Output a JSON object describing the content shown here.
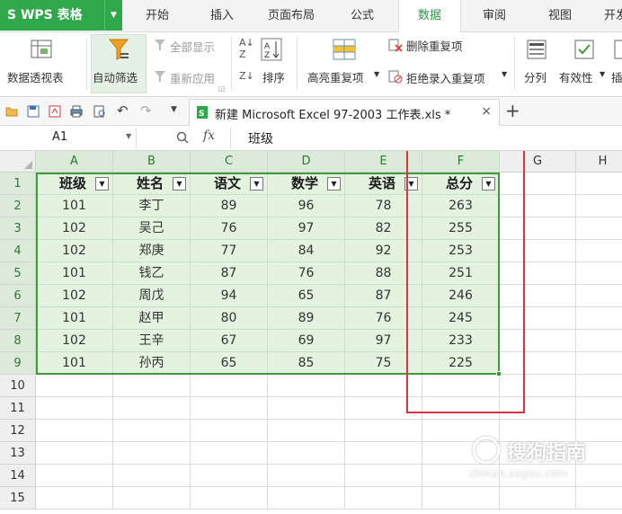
{
  "app": {
    "logo": "S WPS 表格",
    "tabs": [
      "开始",
      "插入",
      "页面布局",
      "公式",
      "数据",
      "审阅",
      "视图",
      "开发"
    ],
    "active_tab": "数据"
  },
  "ribbon": {
    "pivot": "数据透视表",
    "autofilter": "自动筛选",
    "show_all": "全部显示",
    "reapply": "重新应用",
    "sort": "排序",
    "highlight_dup": "高亮重复项",
    "remove_dup": "删除重复项",
    "reject_dup": "拒绝录入重复项",
    "split_col": "分列",
    "validity": "有效性",
    "insert_more": "插"
  },
  "doc": {
    "title": "新建 Microsoft Excel 97-2003 工作表.xls *",
    "close": "×",
    "new_tab": "+"
  },
  "formula_bar": {
    "cell_ref": "A1",
    "fx": "fx",
    "value": "班级"
  },
  "sheet": {
    "columns": [
      "A",
      "B",
      "C",
      "D",
      "E",
      "F",
      "G",
      "H"
    ],
    "rows": [
      "1",
      "2",
      "3",
      "4",
      "5",
      "6",
      "7",
      "8",
      "9",
      "10",
      "11",
      "12",
      "13",
      "14",
      "15"
    ],
    "headers": [
      "班级",
      "姓名",
      "语文",
      "数学",
      "英语",
      "总分"
    ],
    "data": [
      [
        "101",
        "李丁",
        "89",
        "96",
        "78",
        "263"
      ],
      [
        "102",
        "吴己",
        "76",
        "97",
        "82",
        "255"
      ],
      [
        "102",
        "郑庚",
        "77",
        "84",
        "92",
        "253"
      ],
      [
        "101",
        "钱乙",
        "87",
        "76",
        "88",
        "251"
      ],
      [
        "102",
        "周戊",
        "94",
        "65",
        "87",
        "246"
      ],
      [
        "101",
        "赵甲",
        "80",
        "89",
        "76",
        "245"
      ],
      [
        "102",
        "王辛",
        "67",
        "69",
        "97",
        "233"
      ],
      [
        "101",
        "孙丙",
        "65",
        "85",
        "75",
        "225"
      ]
    ],
    "filter_glyph": "▼"
  },
  "watermark": {
    "brand": "搜狗指南",
    "url": "zhinan.sogou.com"
  },
  "colors": {
    "brand_green": "#2ea84a",
    "selection_green": "#3e9d3a",
    "highlight_red": "#d9363e",
    "range_fill": "#e3f3df"
  }
}
